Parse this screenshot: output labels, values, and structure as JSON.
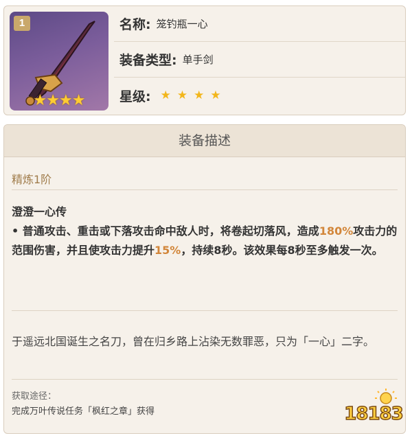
{
  "item": {
    "refinement_badge": "1",
    "rarity_stars": "★★★★",
    "name_label": "名称:",
    "name_value": "笼钓瓶一心",
    "type_label": "装备类型:",
    "type_value": "单手剑",
    "rarity_label": "星级:",
    "rarity_value": "★★★★",
    "rarity_count": 4
  },
  "description": {
    "header": "装备描述",
    "refinement": "精炼1阶",
    "skill_name": "澄澄一心传",
    "skill_text_1": "• 普通攻击、重击或下落攻击命中敌人时，将卷起切落风，造成",
    "skill_hl_1": "180%",
    "skill_text_2": "攻击力的范围伤害，并且使攻击力提升",
    "skill_hl_2": "15%",
    "skill_text_3": "，持续8秒。该效果每8秒至多触发一次。",
    "lore": "于遥远北国诞生之名刀，曾在归乡路上沾染无数罪恶，只为「一心」二字。",
    "source_label": "获取途径：",
    "source_text": "完成万叶传说任务「枫红之章」获得"
  },
  "watermark": {
    "text": "18183"
  },
  "colors": {
    "highlight": "#d2863a",
    "refine": "#a07c4b",
    "star": "#f2b61b"
  }
}
